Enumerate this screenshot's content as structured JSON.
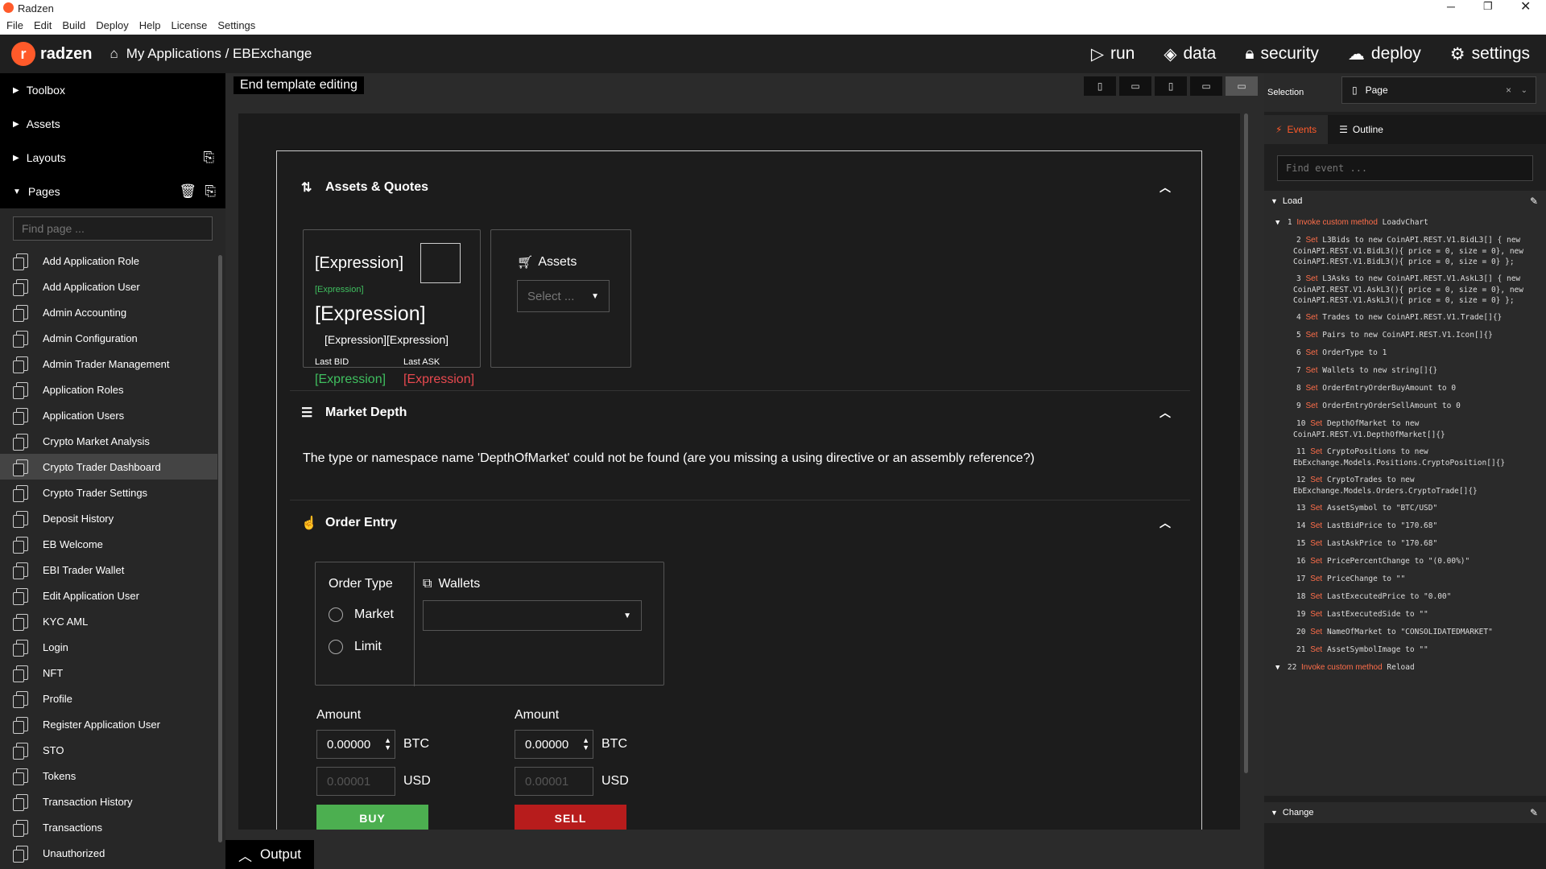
{
  "app": {
    "title": "Radzen",
    "menu": [
      "File",
      "Edit",
      "Build",
      "Deploy",
      "Help",
      "License",
      "Settings"
    ]
  },
  "topbar": {
    "logo": "radzen",
    "breadcrumb": "My Applications / EBExchange",
    "nav": [
      {
        "icon": "play-icon",
        "label": "run"
      },
      {
        "icon": "database-icon",
        "label": "data"
      },
      {
        "icon": "lock-icon",
        "label": "security"
      },
      {
        "icon": "cloud-icon",
        "label": "deploy"
      },
      {
        "icon": "gear-icon",
        "label": "settings"
      }
    ]
  },
  "left": {
    "sections": [
      "Toolbox",
      "Assets",
      "Layouts",
      "Pages"
    ],
    "find_placeholder": "Find page ...",
    "pages": [
      "Add Application Role",
      "Add Application User",
      "Admin Accounting",
      "Admin Configuration",
      "Admin Trader Management",
      "Application Roles",
      "Application Users",
      "Crypto Market Analysis",
      "Crypto Trader Dashboard",
      "Crypto Trader Settings",
      "Deposit History",
      "EB Welcome",
      "EBI Trader Wallet",
      "Edit Application User",
      "KYC AML",
      "Login",
      "NFT",
      "Profile",
      "Register Application User",
      "STO",
      "Tokens",
      "Transaction History",
      "Transactions",
      "Unauthorized"
    ],
    "selected": "Crypto Trader Dashboard"
  },
  "canvas": {
    "end_template": "End template editing",
    "output": "Output",
    "assets_panel": {
      "title": "Assets & Quotes",
      "expr": "[Expression]",
      "expr_pair": "[Expression][Expression]",
      "last_bid": "Last BID",
      "last_ask": "Last ASK",
      "assets_label": "Assets",
      "select_placeholder": "Select ..."
    },
    "market_depth": {
      "title": "Market Depth",
      "error": "The type or namespace name 'DepthOfMarket' could not be found (are you missing a using directive or an assembly reference?)"
    },
    "order_entry": {
      "title": "Order Entry",
      "order_type": "Order Type",
      "market": "Market",
      "limit": "Limit",
      "wallets": "Wallets",
      "amount": "Amount",
      "amount_value": "0.00000",
      "amount_placeholder": "0.00001",
      "btc": "BTC",
      "usd": "USD",
      "buy": "BUY",
      "sell": "SELL"
    }
  },
  "right": {
    "selection_label": "Selection",
    "selection_value": "Page",
    "tabs": [
      "Events",
      "Outline"
    ],
    "find_placeholder": "Find event ...",
    "load": "Load",
    "change": "Change",
    "events": [
      {
        "n": "1",
        "k": "Invoke custom method",
        "v": "LoadvChart",
        "head": true
      },
      {
        "n": "2",
        "k": "Set",
        "v": "L3Bids  to new CoinAPI.REST.V1.BidL3[] { new CoinAPI.REST.V1.BidL3(){ price = 0, size = 0}, new CoinAPI.REST.V1.BidL3(){ price = 0, size = 0} };"
      },
      {
        "n": "3",
        "k": "Set",
        "v": "L3Asks  to new CoinAPI.REST.V1.AskL3[] { new CoinAPI.REST.V1.AskL3(){ price = 0, size = 0}, new CoinAPI.REST.V1.AskL3(){ price = 0, size = 0} };"
      },
      {
        "n": "4",
        "k": "Set",
        "v": "Trades  to new CoinAPI.REST.V1.Trade[]{}"
      },
      {
        "n": "5",
        "k": "Set",
        "v": "Pairs  to new CoinAPI.REST.V1.Icon[]{}"
      },
      {
        "n": "6",
        "k": "Set",
        "v": "OrderType  to 1"
      },
      {
        "n": "7",
        "k": "Set",
        "v": "Wallets  to new string[]{}"
      },
      {
        "n": "8",
        "k": "Set",
        "v": "OrderEntryOrderBuyAmount  to 0"
      },
      {
        "n": "9",
        "k": "Set",
        "v": "OrderEntryOrderSellAmount  to 0"
      },
      {
        "n": "10",
        "k": "Set",
        "v": "DepthOfMarket  to new CoinAPI.REST.V1.DepthOfMarket[]{}"
      },
      {
        "n": "11",
        "k": "Set",
        "v": "CryptoPositions  to new EbExchange.Models.Positions.CryptoPosition[]{}"
      },
      {
        "n": "12",
        "k": "Set",
        "v": "CryptoTrades  to new EbExchange.Models.Orders.CryptoTrade[]{}"
      },
      {
        "n": "13",
        "k": "Set",
        "v": "AssetSymbol  to \"BTC/USD\""
      },
      {
        "n": "14",
        "k": "Set",
        "v": "LastBidPrice  to \"170.68\""
      },
      {
        "n": "15",
        "k": "Set",
        "v": "LastAskPrice  to \"170.68\""
      },
      {
        "n": "16",
        "k": "Set",
        "v": "PricePercentChange  to \"(0.00%)\""
      },
      {
        "n": "17",
        "k": "Set",
        "v": "PriceChange  to \"\""
      },
      {
        "n": "18",
        "k": "Set",
        "v": "LastExecutedPrice  to \"0.00\""
      },
      {
        "n": "19",
        "k": "Set",
        "v": "LastExecutedSide  to \"\""
      },
      {
        "n": "20",
        "k": "Set",
        "v": "NameOfMarket  to \"CONSOLIDATEDMARKET\""
      },
      {
        "n": "21",
        "k": "Set",
        "v": "AssetSymbolImage  to \"\""
      },
      {
        "n": "22",
        "k": "Invoke custom method",
        "v": "Reload",
        "head": true
      }
    ]
  }
}
